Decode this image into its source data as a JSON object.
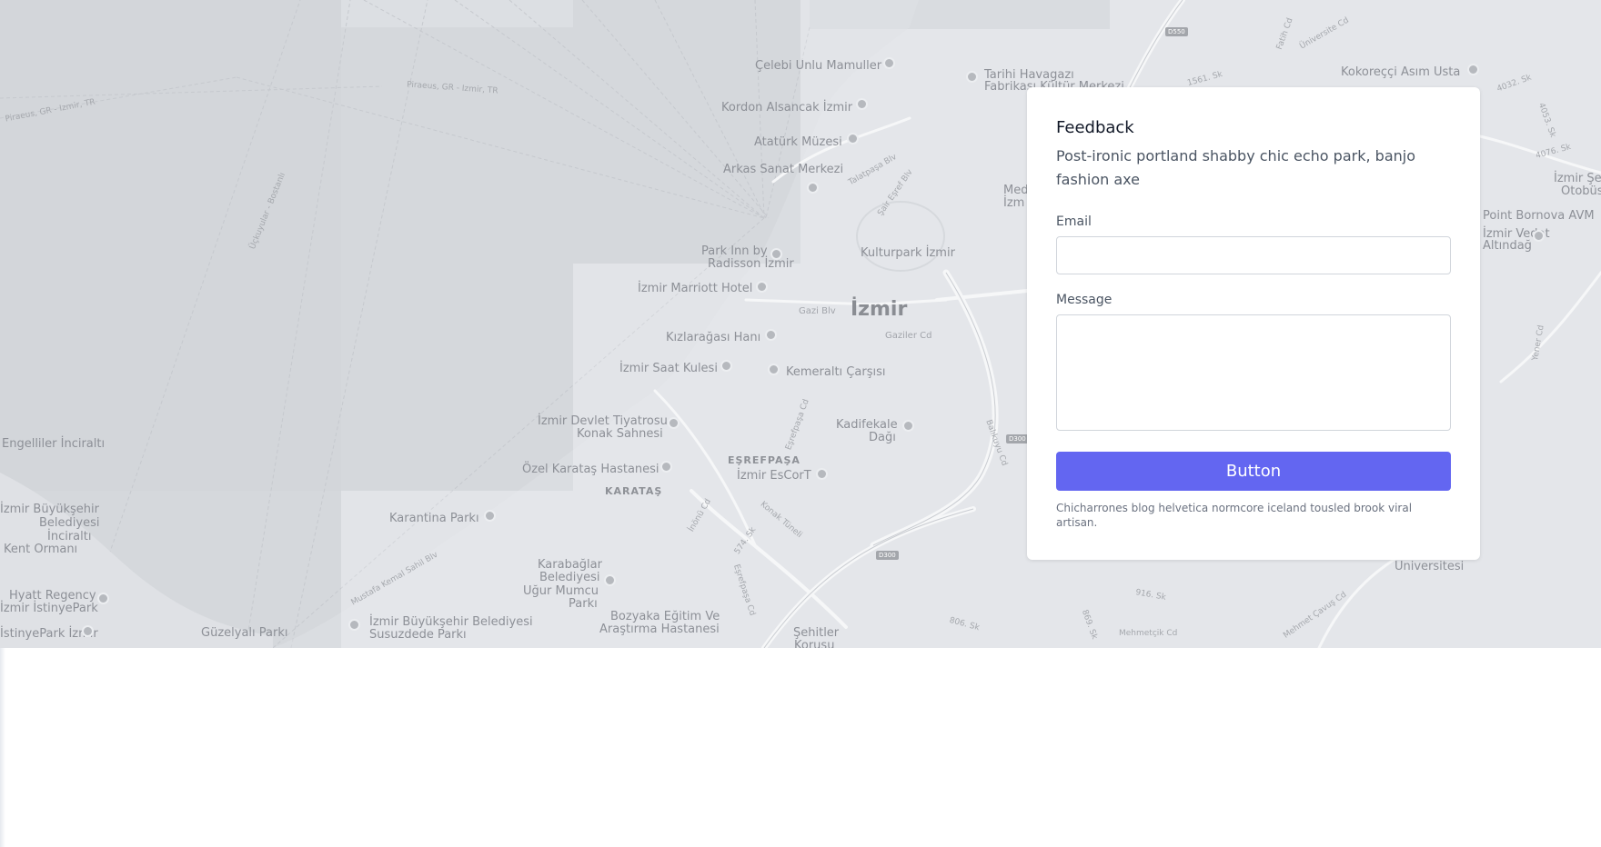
{
  "map": {
    "places": {
      "celebi": "Çelebi Unlu Mamuller",
      "havagazi": "Tarihi Havagazı",
      "havagazi2": "Fabrikası Kültür Merkezi",
      "kokorecci": "Kokoreççi Asım Usta",
      "kordon": "Kordon Alsancak İzmir",
      "ataturk": "Atatürk Müzesi",
      "arkas": "Arkas Sanat Merkezi",
      "parkinn": "Park Inn by",
      "parkinn2": "Radisson İzmir",
      "kulturpark": "Kulturpark İzmir",
      "marriott": "İzmir Marriott Hotel",
      "kizlaragasi": "Kızlarağası Hanı",
      "saatkulesi": "İzmir Saat Kulesi",
      "kemeralti": "Kemeraltı Çarşısı",
      "devlet": "İzmir Devlet Tiyatrosu",
      "devlet2": "Konak Sahnesi",
      "kadifekale": "Kadifekale",
      "kadifekale2": "Dağı",
      "karatas_hastane": "Özel Karataş Hastanesi",
      "escort": "İzmir EsCorT",
      "engelliler": "Engelliler İnciraltı",
      "buyuksehir1": "İzmir Büyükşehir",
      "buyuksehir2": "Belediyesi",
      "buyuksehir3": "İnciraltı",
      "buyuksehir4": "Kent Ormanı",
      "karantina": "Karantina Parkı",
      "karabaglar1": "Karabağlar",
      "karabaglar2": "Belediyesi",
      "karabaglar3": "Uğur Mumcu",
      "karabaglar4": "Parkı",
      "hyatt1": "Hyatt Regency",
      "hyatt2": "İzmir İstinyePark",
      "istinye": "İstinyePark İzmir",
      "guzelyali": "Güzelyalı Parkı",
      "susuz1": "İzmir Büyükşehir Belediyesi",
      "susuz2": "Susuzdede Parkı",
      "bozyaka1": "Bozyaka Eğitim Ve",
      "bozyaka2": "Araştırma Hastanesi",
      "sehitler1": "Şehitler",
      "sehitler2": "Korusu",
      "bornova1": "Point Bornova AVM",
      "bornova2": "İzmir Vedat",
      "bornova3": "Altındağ",
      "izmir_otobus1": "İzmir Şe",
      "izmir_otobus2": "Otobüs",
      "universitesi": "Üniversitesi",
      "med1": "Med",
      "med2": "İzm"
    },
    "city": "İzmir",
    "districts": {
      "esrefpasa": "EŞREFPAŞA",
      "karatas": "KARATAŞ"
    },
    "streets": {
      "piraeus1": "Piraeus, GR - Izmir, TR",
      "piraeus2": "Piraeus, GR - Izmir, TR",
      "uckuyular": "Üçkuyular - Bostanlı",
      "talatpasa": "Talatpaşa Blv",
      "sair": "Şair Eşref Blv",
      "gazi": "Gazi Blv",
      "gaziler": "Gaziler Cd",
      "esrefpasa_cd": "Eşrefpaşa Cd",
      "balikuyu": "Balıkuyu Cd",
      "inonu": "İnönü Cd",
      "s574": "574. Sk",
      "konak_tuneli": "Konak Tüneli",
      "esrefpasa_cd2": "Eşrefpaşa Cd",
      "mustafa": "Mustafa Kemal Sahil Blv",
      "s1561": "1561. Sk",
      "fatih": "Fatih Cd",
      "universite": "Üniversite Cd",
      "s4032": "4032. Sk",
      "s4076": "4076. Sk",
      "s4053": "4053. Sk",
      "yener": "Yener Cd",
      "s916": "916. Sk",
      "s806": "806. Sk",
      "s869": "869. Sk",
      "mehmetcik": "Mehmetçik Cd",
      "mehmet_cavus": "Mehmet Çavuş Cd"
    },
    "routes": {
      "d550": "D550",
      "d300a": "D300",
      "d300b": "D300"
    }
  },
  "form": {
    "title": "Feedback",
    "description": "Post-ironic portland shabby chic echo park, banjo fashion axe",
    "email_label": "Email",
    "email_value": "",
    "message_label": "Message",
    "message_value": "",
    "button_label": "Button",
    "note": "Chicharrones blog helvetica normcore iceland tousled brook viral artisan."
  },
  "colors": {
    "accent": "#6366f1",
    "map_bg": "#e4e6ea",
    "water": "#d3d6db"
  }
}
